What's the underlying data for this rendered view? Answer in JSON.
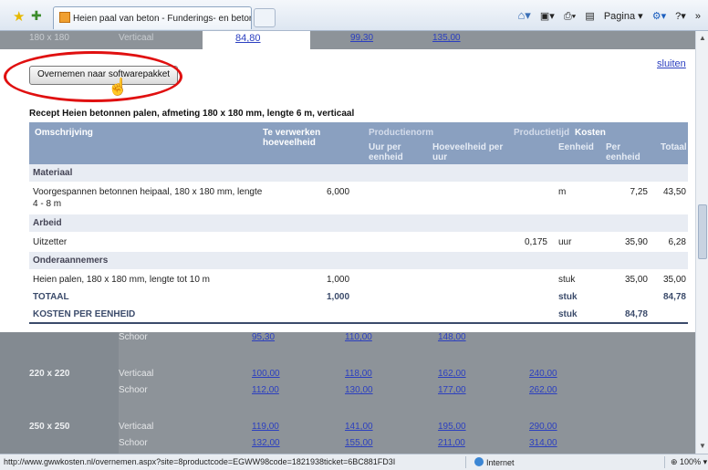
{
  "browser": {
    "tab_title": "Heien paal van beton - Funderings- en betonconstruc...",
    "page_menu": "Pagina",
    "status_url": "http://www.gwwkosten.nl/overnemen.aspx?site=8productcode=EGWW98code=1821938ticket=6BC881FD3I",
    "status_zone": "Internet",
    "zoom": "100%"
  },
  "top_strip": {
    "size": "180 x 180",
    "orientation": "Verticaal",
    "selected_value": "84,80",
    "values": [
      "99,30",
      "135,00"
    ]
  },
  "actions": {
    "overnemen_label": "Overnemen naar softwarepakket",
    "close_label": "sluiten"
  },
  "recipe": {
    "title": "Recept Heien betonnen palen, afmeting 180 x 180 mm, lengte 6 m, verticaal",
    "headers": {
      "omschrijving": "Omschrijving",
      "te_verwerken": "Te verwerken",
      "hoeveelheid": "hoeveelheid",
      "productienorm": "Productienorm",
      "uur_per": "Uur per",
      "eenheid_sub": "eenheid",
      "hoeveelheid_per": "Hoeveelheid per",
      "uur": "uur",
      "productietijd": "Productietijd",
      "kosten": "Kosten",
      "eenheid": "Eenheid",
      "per": "Per",
      "per_eenheid": "eenheid",
      "totaal": "Totaal"
    },
    "sections": {
      "materiaal": "Materiaal",
      "arbeid": "Arbeid",
      "onderaannemers": "Onderaannemers"
    },
    "rows": {
      "materiaal": {
        "desc1": "Voorgespannen betonnen heipaal, 180 x 180 mm, lengte",
        "desc2": "4 - 8 m",
        "qty": "6,000",
        "unit": "m",
        "per": "7,25",
        "total": "43,50"
      },
      "arbeid": {
        "desc": "Uitzetter",
        "tijd": "0,175",
        "unit": "uur",
        "per": "35,90",
        "total": "6,28"
      },
      "onder": {
        "desc": "Heien palen, 180 x 180 mm, lengte tot 10 m",
        "qty": "1,000",
        "unit": "stuk",
        "per": "35,00",
        "total": "35,00"
      }
    },
    "totaal": {
      "label": "TOTAAL",
      "qty": "1,000",
      "unit": "stuk",
      "total": "84,78"
    },
    "kosten_per_eenheid": {
      "label": "KOSTEN PER EENHEID",
      "unit": "stuk",
      "per": "84,78"
    }
  },
  "size_table": {
    "r1": {
      "orientation": "Schoor",
      "v1": "95,30",
      "v2": "110,00",
      "v3": "148,00"
    },
    "r2": {
      "size": "220 x 220",
      "orientation": "Verticaal",
      "v1": "100,00",
      "v2": "118,00",
      "v3": "162,00",
      "v4": "240,00"
    },
    "r3": {
      "orientation": "Schoor",
      "v1": "112,00",
      "v2": "130,00",
      "v3": "177,00",
      "v4": "262,00"
    },
    "r4": {
      "size": "250 x 250",
      "orientation": "Verticaal",
      "v1": "119,00",
      "v2": "141,00",
      "v3": "195,00",
      "v4": "290,00"
    },
    "r5": {
      "orientation": "Schoor",
      "v1": "132,00",
      "v2": "155,00",
      "v3": "211,00",
      "v4": "314,00"
    }
  }
}
